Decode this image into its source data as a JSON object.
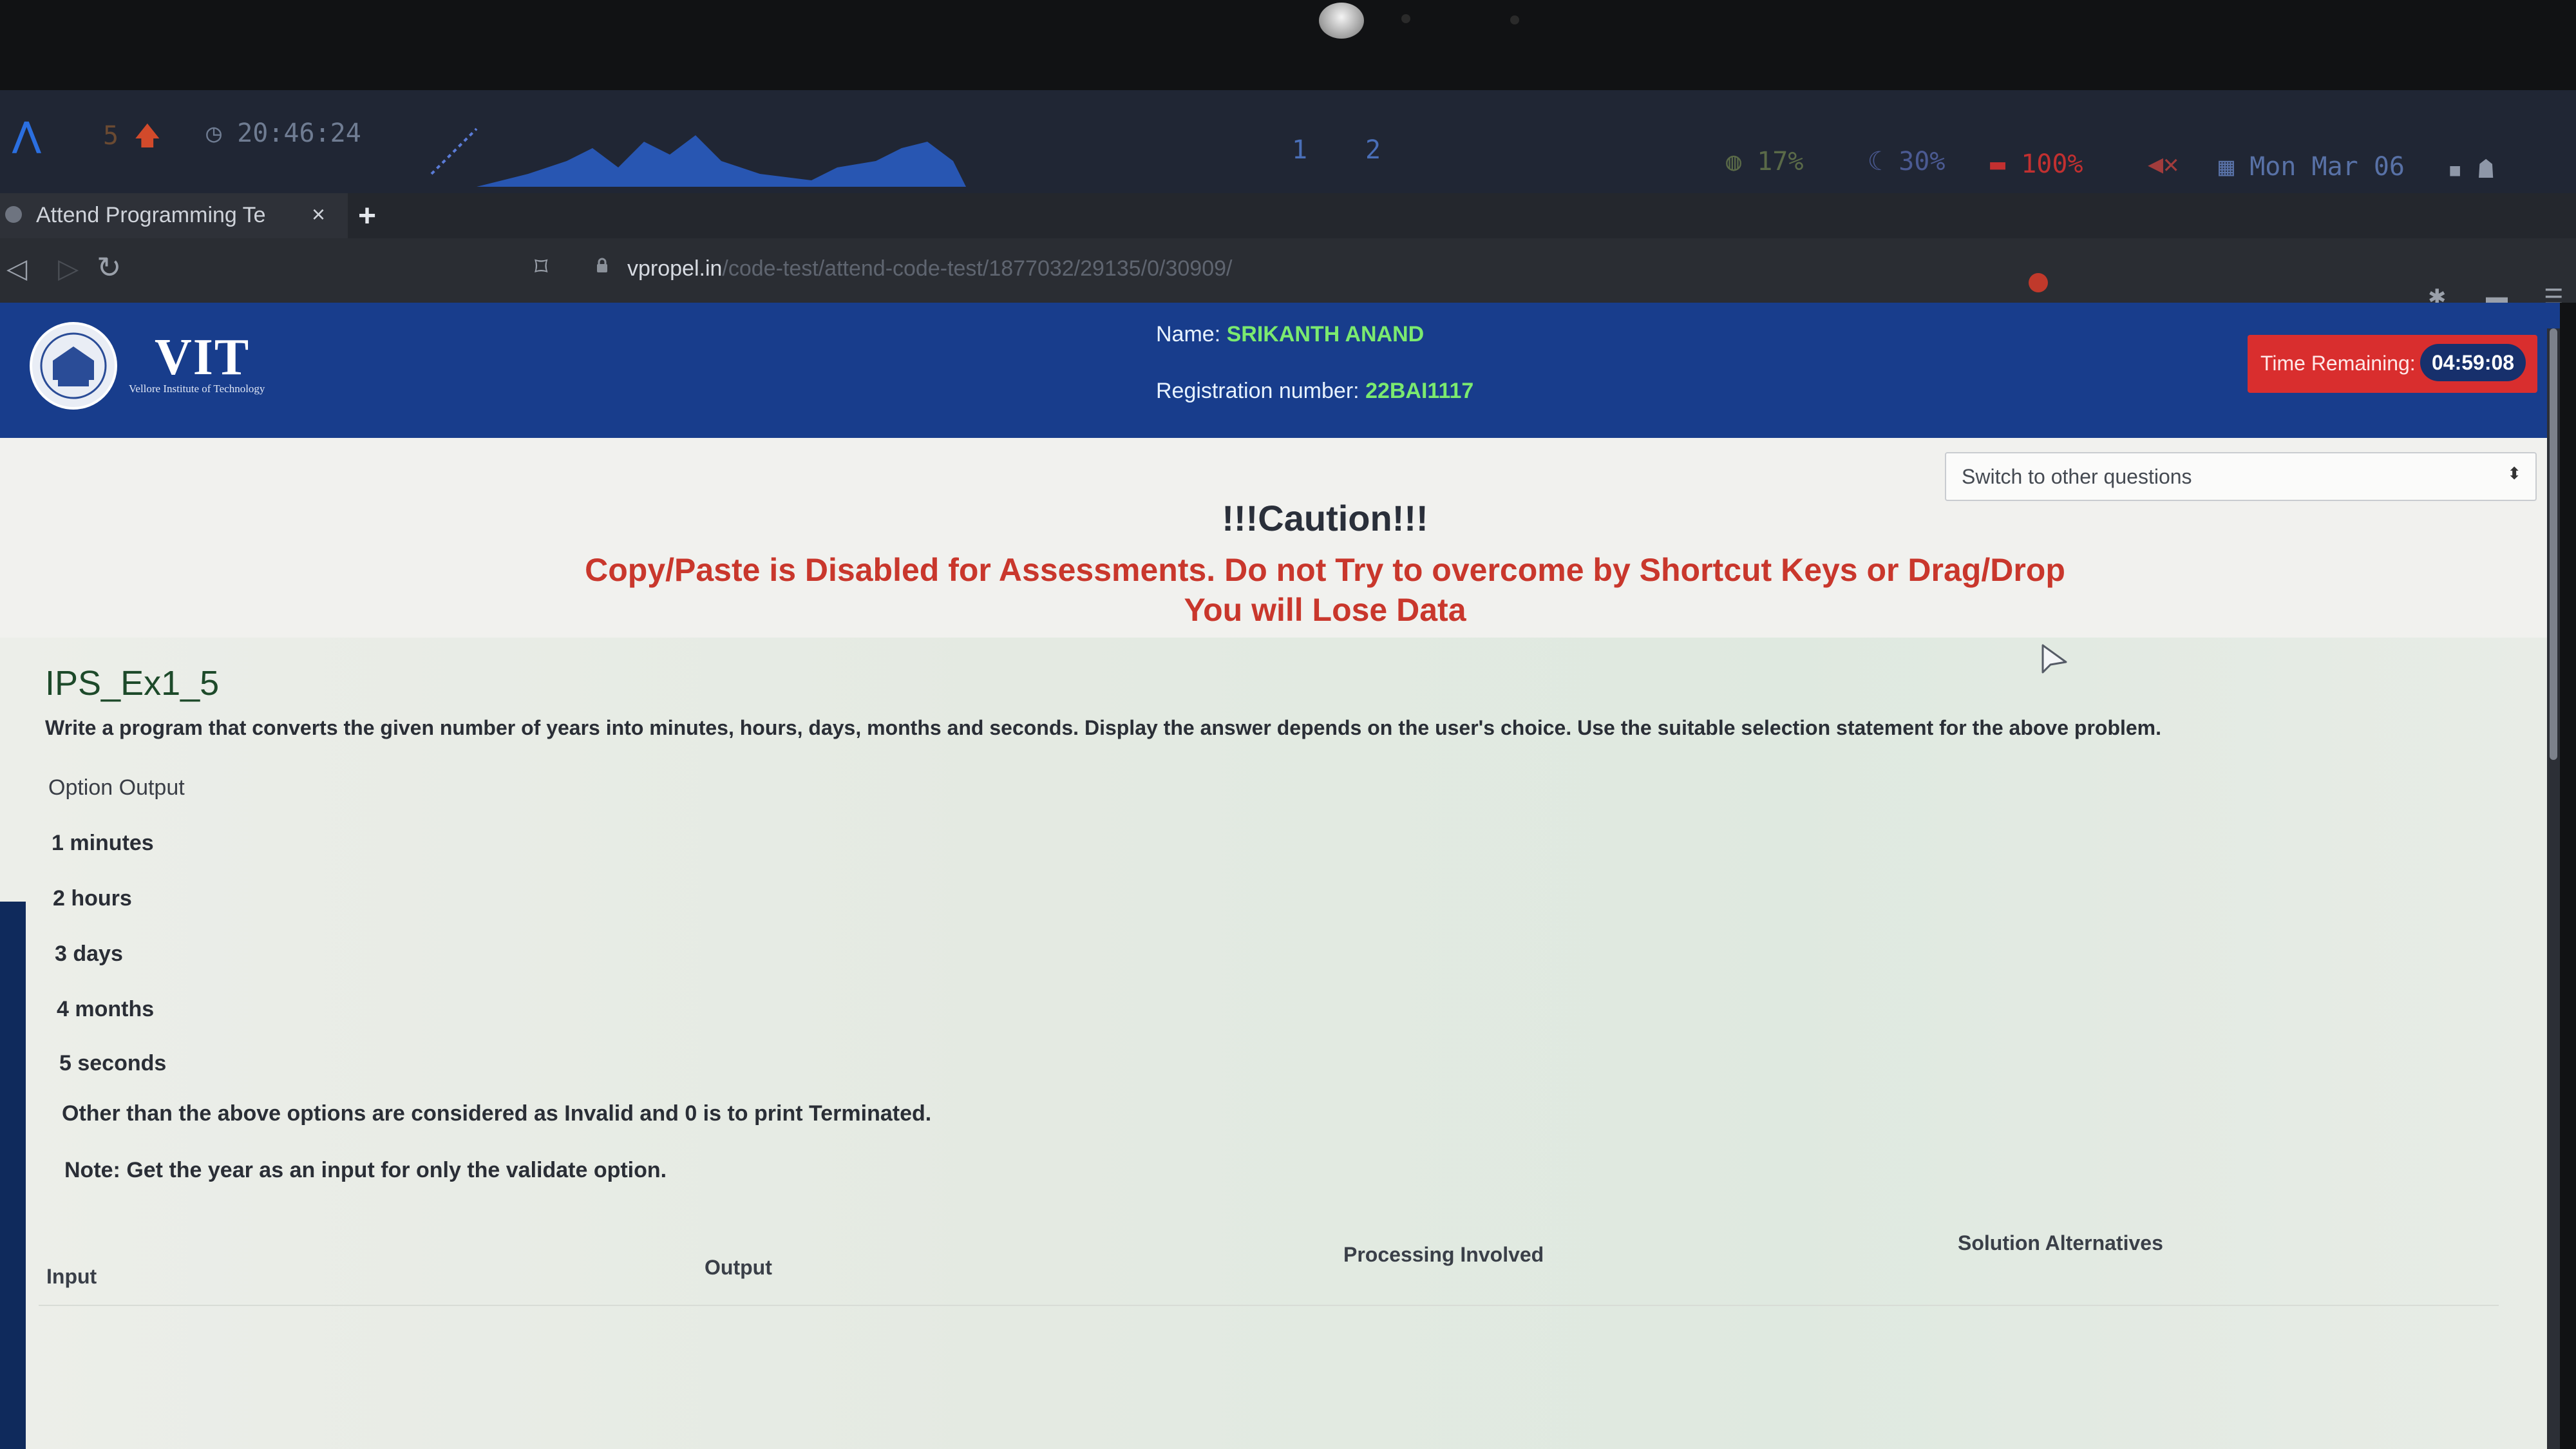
{
  "system_bar": {
    "updates_count": "5",
    "clock": "20:46:24",
    "workspaces": [
      "1",
      "2"
    ],
    "cpu": "17%",
    "memory": "30%",
    "battery": "100%",
    "date": "Mon Mar 06"
  },
  "browser": {
    "tab_title": "Attend Programming Te",
    "tab_close": "×",
    "new_tab": "+",
    "url_domain": "vpropel.in",
    "url_path": "/code-test/attend-code-test/1877032/29135/0/30909/"
  },
  "header": {
    "logo_text": "VIT",
    "logo_subtitle": "Vellore Institute of Technology",
    "name_label": "Name:",
    "name_value": "SRIKANTH ANAND",
    "reg_label": "Registration number:",
    "reg_value": "22BAI1117",
    "time_label": "Time Remaining:",
    "time_value": "04:59:08"
  },
  "question_switcher": {
    "placeholder": "Switch to other questions"
  },
  "caution": {
    "title": "!!!Caution!!!",
    "line1": "Copy/Paste is Disabled for Assessments. Do not Try to overcome by Shortcut Keys or Drag/Drop",
    "line2": "You will Lose Data"
  },
  "question": {
    "title": "IPS_Ex1_5",
    "description": "Write a program that converts the given number of years into minutes, hours, days, months and seconds. Display the answer depends on the user's choice. Use the suitable selection statement for the above problem.",
    "options_header": "Option Output",
    "options": [
      "1 minutes",
      "2 hours",
      "3 days",
      "4 months",
      "5 seconds"
    ],
    "other_note": "Other than the above options are considered as Invalid and 0 is to print Terminated.",
    "note": "Note: Get the year as  an input for only the validate option."
  },
  "table_headers": {
    "input": "Input",
    "output": "Output",
    "processing": "Processing Involved",
    "solution": "Solution Alternatives"
  },
  "colors": {
    "header_bg": "#183d8c",
    "timer_bg": "#d92e2e",
    "caution_red": "#c9372c",
    "name_green": "#7bea6f"
  }
}
